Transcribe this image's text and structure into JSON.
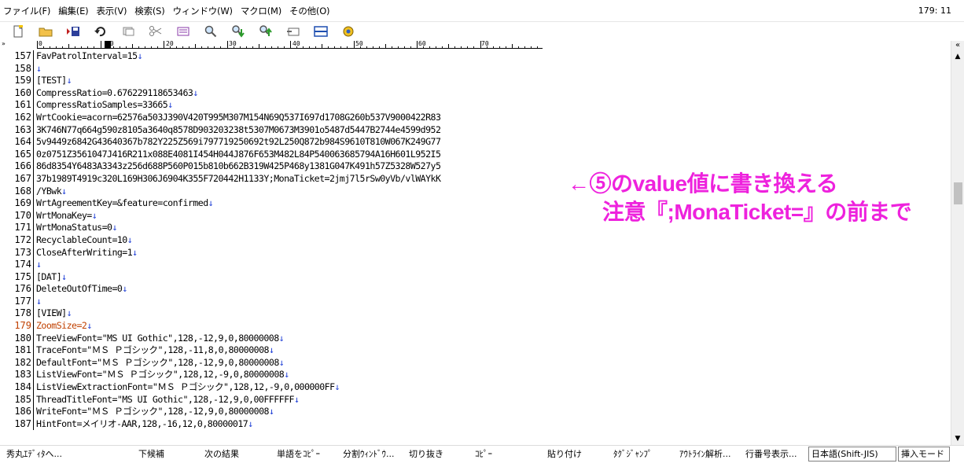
{
  "menu": {
    "items": [
      "ファイル(F)",
      "編集(E)",
      "表示(V)",
      "検索(S)",
      "ウィンドウ(W)",
      "マクロ(M)",
      "その他(O)"
    ],
    "cursor_position": "179: 11"
  },
  "toolbar": {
    "icons": [
      "new-file-icon",
      "open-folder-icon",
      "save-icon",
      "undo-icon",
      "copy-icon",
      "cut-icon",
      "paste-icon",
      "search-icon",
      "search-next-icon",
      "search-prev-icon",
      "tag-jump-icon",
      "split-window-icon",
      "settings-icon"
    ]
  },
  "ruler": {
    "labels": [
      "0",
      "10",
      "20",
      "30",
      "40",
      "50",
      "60",
      "70"
    ]
  },
  "editor": {
    "lines": [
      {
        "num": "157",
        "text": "FavPatrolInterval=15",
        "eol": "↓"
      },
      {
        "num": "158",
        "text": "",
        "eol": "↓"
      },
      {
        "num": "159",
        "text": "[TEST]",
        "eol": "↓"
      },
      {
        "num": "160",
        "text": "CompressRatio=0.676229118653463",
        "eol": "↓"
      },
      {
        "num": "161",
        "text": "CompressRatioSamples=33665",
        "eol": "↓"
      },
      {
        "num": "162",
        "text": "WrtCookie=acorn=62576a503J390V420T995M307M154N69Q537I697d1708G260b537V9000422R83",
        "eol": ""
      },
      {
        "num": "163",
        "text": "3K746N77q664g590z8105a3640q8578D903203238t5307M0673M3901o5487d5447B2744e4599d952",
        "eol": ""
      },
      {
        "num": "164",
        "text": "5v9449z6842G43640367b782Y225Z569i797719250692t92L250Q872b984S9610T810W067K249G77",
        "eol": ""
      },
      {
        "num": "165",
        "text": "0z0751Z3561047J416R211x088E4081I454H044J876F653M482L84P540063685794A16H601L952I5",
        "eol": ""
      },
      {
        "num": "166",
        "text": "86d8354Y6483A3343z256d688P560P015b810b662B319W425P468y1381G047K491h57Z5328W527y5",
        "eol": ""
      },
      {
        "num": "167",
        "text": "37b1989T4919c320L169H306J6904K355F720442H1133Y;MonaTicket=2jmj7l5rSw0yVb/vlWAYkK",
        "eol": ""
      },
      {
        "num": "168",
        "text": "/YBwk",
        "eol": "↓"
      },
      {
        "num": "169",
        "text": "WrtAgreementKey=&feature=confirmed",
        "eol": "↓"
      },
      {
        "num": "170",
        "text": "WrtMonaKey=",
        "eol": "↓"
      },
      {
        "num": "171",
        "text": "WrtMonaStatus=0",
        "eol": "↓"
      },
      {
        "num": "172",
        "text": "RecyclableCount=10",
        "eol": "↓"
      },
      {
        "num": "173",
        "text": "CloseAfterWriting=1",
        "eol": "↓"
      },
      {
        "num": "174",
        "text": "",
        "eol": "↓"
      },
      {
        "num": "175",
        "text": "[DAT]",
        "eol": "↓"
      },
      {
        "num": "176",
        "text": "DeleteOutOfTime=0",
        "eol": "↓"
      },
      {
        "num": "177",
        "text": "",
        "eol": "↓"
      },
      {
        "num": "178",
        "text": "[VIEW]",
        "eol": "↓"
      },
      {
        "num": "179",
        "text": "ZoomSize=2",
        "eol": "↓",
        "active": true
      },
      {
        "num": "180",
        "text": "TreeViewFont=\"MS UI Gothic\",128,-12,9,0,80000008",
        "eol": "↓"
      },
      {
        "num": "181",
        "text": "TraceFont=\"ＭＳ Ｐゴシック\",128,-11,8,0,80000008",
        "eol": "↓"
      },
      {
        "num": "182",
        "text": "DefaultFont=\"ＭＳ Ｐゴシック\",128,-12,9,0,80000008",
        "eol": "↓"
      },
      {
        "num": "183",
        "text": "ListViewFont=\"ＭＳ Ｐゴシック\",128,12,-9,0,80000008",
        "eol": "↓"
      },
      {
        "num": "184",
        "text": "ListViewExtractionFont=\"ＭＳ Ｐゴシック\",128,12,-9,0,000000FF",
        "eol": "↓"
      },
      {
        "num": "185",
        "text": "ThreadTitleFont=\"MS UI Gothic\",128,-12,9,0,00FFFFFF",
        "eol": "↓"
      },
      {
        "num": "186",
        "text": "WriteFont=\"ＭＳ Ｐゴシック\",128,-12,9,0,80000008",
        "eol": "↓"
      },
      {
        "num": "187",
        "text": "HintFont=メイリオ-AAR,128,-16,12,0,80000017",
        "eol": "↓"
      }
    ]
  },
  "annotation": {
    "line1": "←⑤のvalue値に書き換える",
    "line2": "注意『;MonaTicket=』の前まで",
    "color": "#ee22dd"
  },
  "statusbar": {
    "items": [
      "秀丸ｴﾃﾞｨﾀへ...",
      "下候補",
      "次の結果",
      "単語をｺﾋﾟｰ",
      "分割ｳｨﾝﾄﾞｳ...",
      "切り抜き",
      "ｺﾋﾟｰ",
      "貼り付け",
      "ﾀｸﾞｼﾞｬﾝﾌﾟ",
      "ｱｳﾄﾗｲﾝ解析...",
      "行番号表示..."
    ],
    "encoding": "日本語(Shift-JIS)",
    "mode": "挿入モード"
  },
  "colors": {
    "eol_marker": "#1f3fd6",
    "active_line": "#c04000",
    "annotation": "#ee22dd"
  }
}
